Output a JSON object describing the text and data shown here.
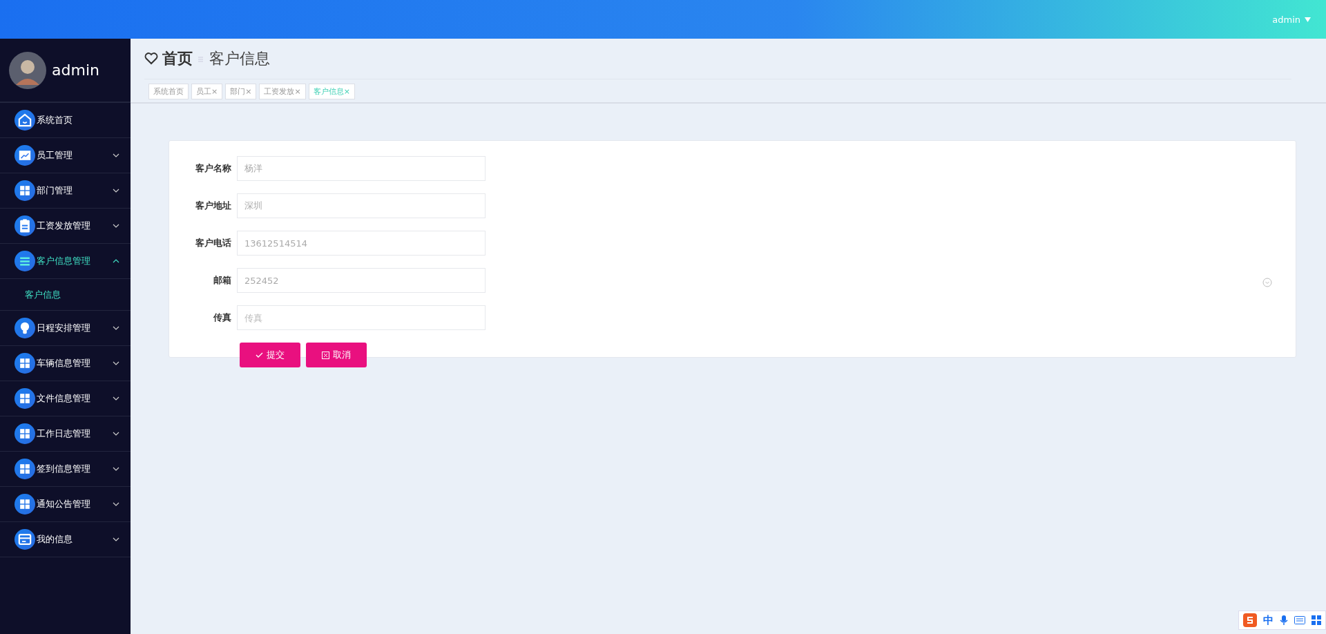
{
  "top_bar": {
    "user": "admin"
  },
  "sidebar": {
    "profile": {
      "name": "admin"
    },
    "items": [
      {
        "label": "系统首页",
        "kind": "link"
      },
      {
        "label": "员工管理",
        "kind": "group",
        "expanded": false
      },
      {
        "label": "部门管理",
        "kind": "group",
        "expanded": false
      },
      {
        "label": "工资发放管理",
        "kind": "group",
        "expanded": false
      },
      {
        "label": "客户信息管理",
        "kind": "group",
        "expanded": true,
        "children": [
          {
            "label": "客户信息",
            "selected": true
          }
        ]
      },
      {
        "label": "日程安排管理",
        "kind": "group",
        "expanded": false
      },
      {
        "label": "车辆信息管理",
        "kind": "group",
        "expanded": false
      },
      {
        "label": "文件信息管理",
        "kind": "group",
        "expanded": false
      },
      {
        "label": "工作日志管理",
        "kind": "group",
        "expanded": false
      },
      {
        "label": "签到信息管理",
        "kind": "group",
        "expanded": false
      },
      {
        "label": "通知公告管理",
        "kind": "group",
        "expanded": false
      },
      {
        "label": "我的信息",
        "kind": "group",
        "expanded": false
      }
    ]
  },
  "breadcrumb": {
    "home": "首页",
    "current": "客户信息"
  },
  "tags": [
    {
      "label": "系统首页",
      "selected": false
    },
    {
      "label": "员工",
      "close": "×",
      "selected": false
    },
    {
      "label": "部门",
      "close": "×",
      "selected": false
    },
    {
      "label": "工资发放",
      "close": "×",
      "selected": false
    },
    {
      "label": "客户信息",
      "close": "×",
      "selected": true
    }
  ],
  "form": {
    "fields": [
      {
        "label": "客户名称",
        "value": "杨洋"
      },
      {
        "label": "客户地址",
        "value": "深圳"
      },
      {
        "label": "客户电话",
        "value": "13612514514"
      },
      {
        "label": "邮箱",
        "value": "252452"
      },
      {
        "label": "传真",
        "placeholder": "传真"
      }
    ],
    "buttons": [
      {
        "label": "提交",
        "kind": "submit"
      },
      {
        "label": "取消",
        "kind": "cancel"
      }
    ]
  },
  "ime_toolbar": {
    "mode": "中"
  }
}
